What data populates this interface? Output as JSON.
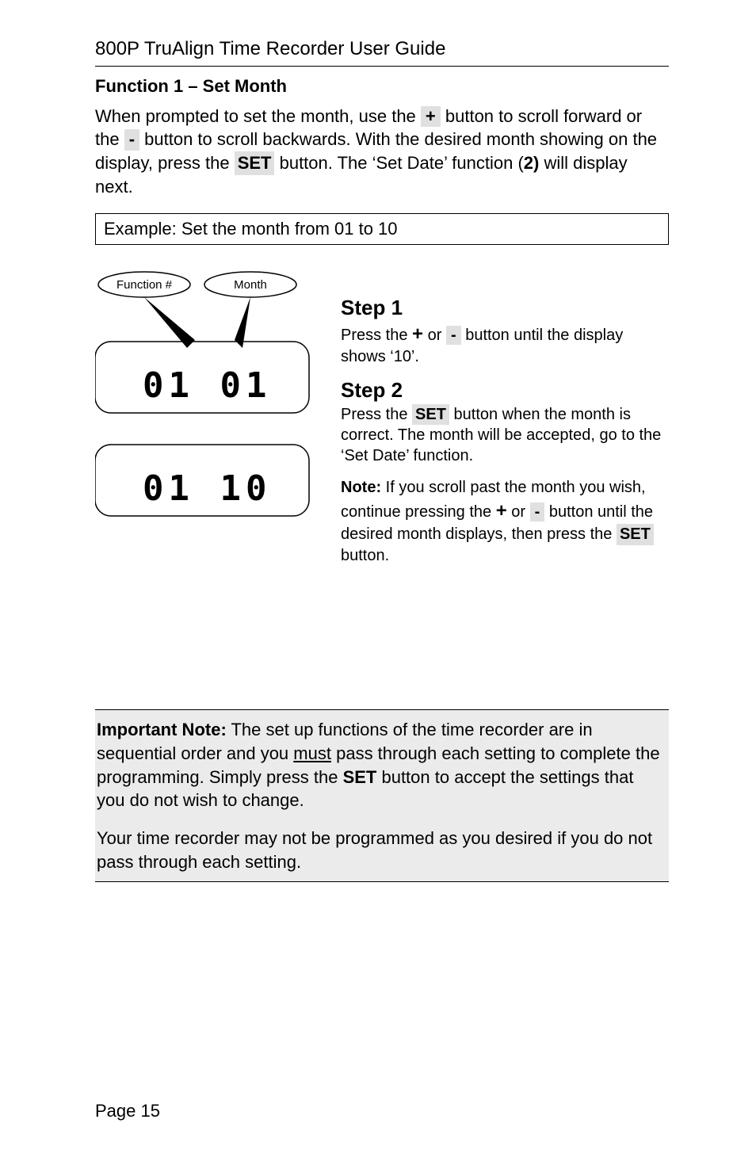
{
  "header": {
    "title": "800P TruAlign Time Recorder User Guide"
  },
  "section": {
    "heading": "Function 1 – Set Month",
    "intro_parts": {
      "p1a": "When prompted to set the month, use the ",
      "plus": "+",
      "p1b": " button to scroll forward or the ",
      "minus": "-",
      "p1c": " button to scroll backwards. With the desired month showing on the display, press the ",
      "set": "SET",
      "p1d": " button. The ‘Set Date’ function (",
      "bold2": "2)",
      "p1e": " will display next."
    },
    "example_label": "Example: Set the month from 01 to 10"
  },
  "diagram": {
    "label_function": "Function #",
    "label_month": "Month",
    "display_before": "01  01",
    "display_after": "01  10"
  },
  "steps": {
    "s1_title": "Step 1",
    "s1_a": "Press the ",
    "s1_plus": "+",
    "s1_or": " or ",
    "s1_minus": "-",
    "s1_b": " button until the display shows ‘10’.",
    "s2_title": "Step 2",
    "s2_a": "Press the ",
    "s2_set": "SET",
    "s2_b": " button when the month is correct. The month will be accepted, go to the ‘Set Date’ function.",
    "note_label": "Note:",
    "note_a": " If you scroll past the month you wish, continue pressing the ",
    "note_plus": "+",
    "note_or": " or ",
    "note_minus": "-",
    "note_b": " button until the desired month displays, then press the ",
    "note_set": "SET",
    "note_c": " button."
  },
  "important": {
    "label": "Important Note:",
    "a": " The set up functions of the time recorder are in sequential order and you ",
    "must": "must",
    "b": " pass through each setting to complete the programming. Simply press the ",
    "set": "SET",
    "c": " button to accept the settings that you do not wish to change.",
    "d": "Your time recorder may not be programmed as you desired if you do not pass through each setting."
  },
  "footer": {
    "page": "Page 15"
  }
}
